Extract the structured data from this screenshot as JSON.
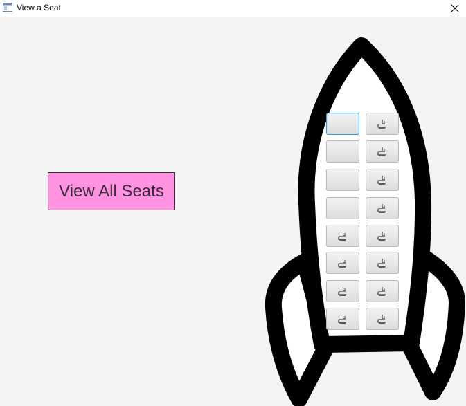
{
  "window": {
    "title": "View a Seat",
    "app_icon": "window-app-icon",
    "close_icon": "close-icon"
  },
  "main": {
    "view_all_label": "View All Seats",
    "button_color": "#ff92e1"
  },
  "seats": {
    "rows": 8,
    "columns": 2,
    "focused": "row1-left",
    "grid": [
      [
        "empty",
        "occupied"
      ],
      [
        "empty",
        "occupied"
      ],
      [
        "empty",
        "occupied"
      ],
      [
        "empty",
        "occupied"
      ],
      [
        "occupied",
        "occupied"
      ],
      [
        "occupied",
        "occupied"
      ],
      [
        "occupied",
        "occupied"
      ],
      [
        "occupied",
        "occupied"
      ]
    ],
    "occupied_icon": "seat-icon"
  }
}
